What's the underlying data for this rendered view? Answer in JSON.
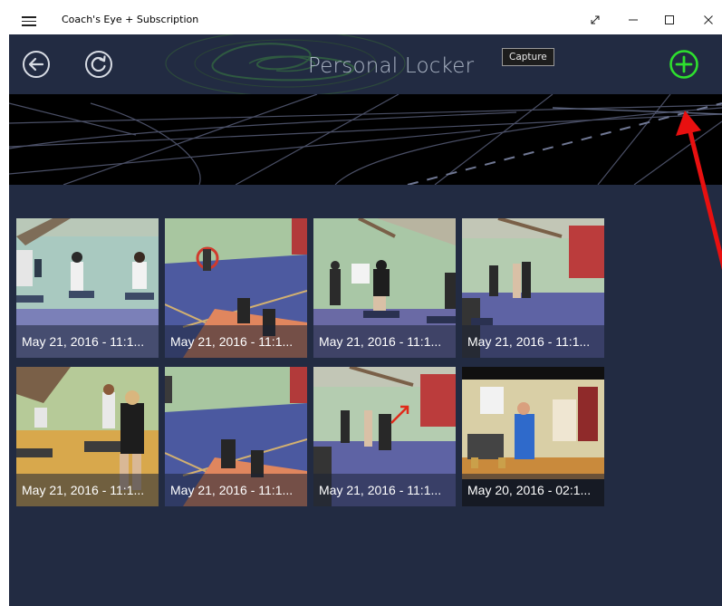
{
  "window": {
    "title": "Coach's Eye + Subscription",
    "controls": [
      "expand-icon",
      "minimize-icon",
      "maximize-icon",
      "close-icon"
    ]
  },
  "header": {
    "page_title": "Personal Locker",
    "tooltip": "Capture",
    "back_icon": "back-arrow-icon",
    "refresh_icon": "refresh-icon",
    "add_icon": "add-plus-icon",
    "accent_green": "#2ee02e"
  },
  "videos": [
    {
      "date": "May 21, 2016 - 11:1..."
    },
    {
      "date": "May 21, 2016 - 11:1..."
    },
    {
      "date": "May 21, 2016 - 11:1..."
    },
    {
      "date": "May 21, 2016 - 11:1..."
    },
    {
      "date": "May 21, 2016 - 11:1..."
    },
    {
      "date": "May 21, 2016 - 11:1..."
    },
    {
      "date": "May 21, 2016 - 11:1..."
    },
    {
      "date": "May 20, 2016 - 02:1..."
    }
  ],
  "colors": {
    "background": "#222b42",
    "annotation_arrow": "#e81010"
  }
}
